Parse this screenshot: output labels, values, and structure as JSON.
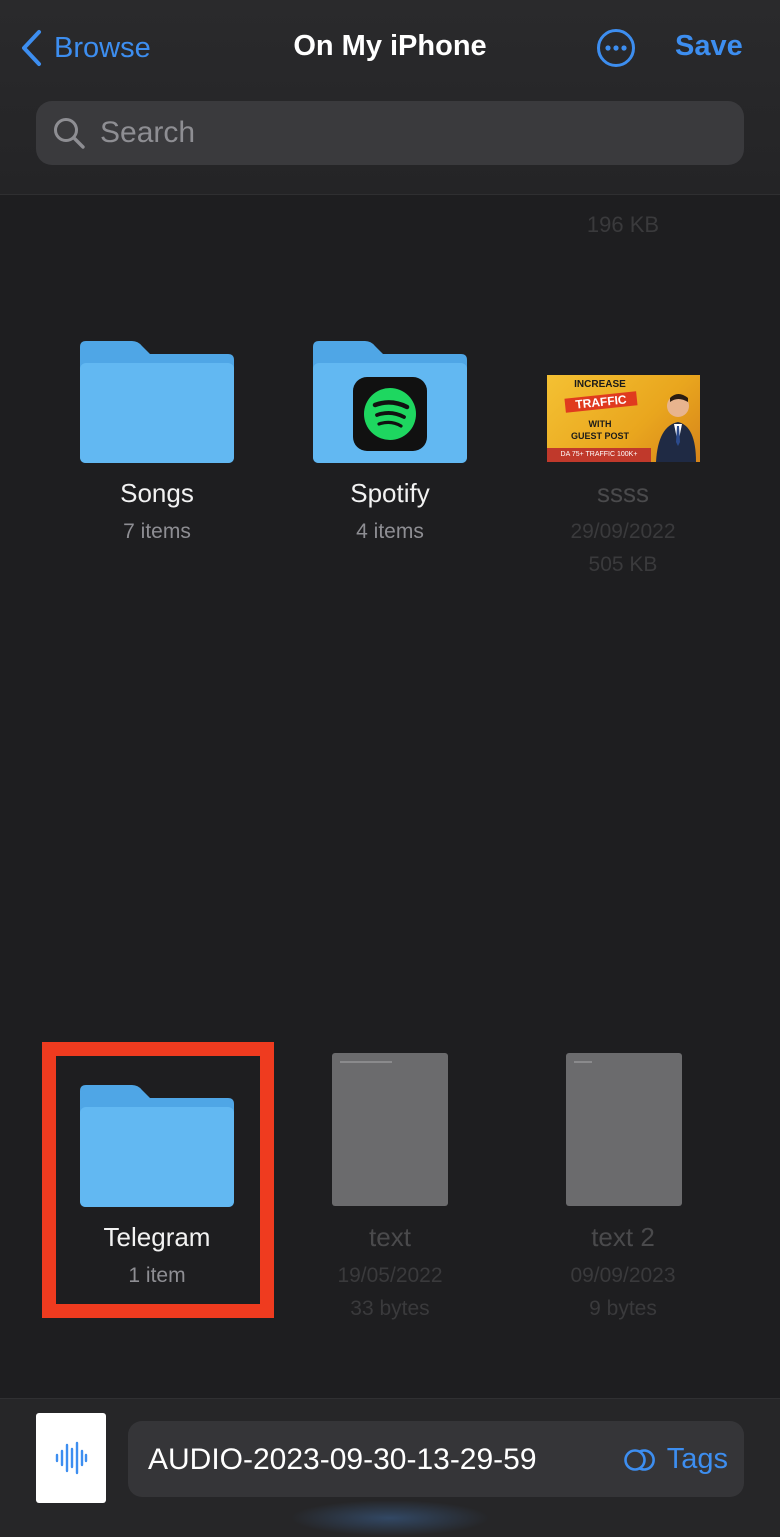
{
  "nav": {
    "back_label": "Browse",
    "title": "On My iPhone",
    "save_label": "Save"
  },
  "search": {
    "placeholder": "Search"
  },
  "cutoff_row": {
    "col3_size": "196 KB"
  },
  "items": [
    {
      "name": "Songs",
      "meta1": "7 items",
      "meta2": "",
      "type": "folder"
    },
    {
      "name": "Spotify",
      "meta1": "4 items",
      "meta2": "",
      "type": "folder-spotify"
    },
    {
      "name": "ssss",
      "meta1": "29/09/2022",
      "meta2": "505 KB",
      "type": "image"
    },
    {
      "name": "Telegram",
      "meta1": "1 item",
      "meta2": "",
      "type": "folder"
    },
    {
      "name": "text",
      "meta1": "19/05/2022",
      "meta2": "33 bytes",
      "type": "document"
    },
    {
      "name": "text 2",
      "meta1": "09/09/2023",
      "meta2": "9 bytes",
      "type": "document"
    }
  ],
  "ad_thumb": {
    "line1": "INCREASE",
    "line2": "TRAFFIC",
    "line3": "WITH",
    "line4": "GUEST POST",
    "line5": "DA 75+ TRAFFIC 100K+"
  },
  "bottom": {
    "filename": "AUDIO-2023-09-30-13-29-59",
    "tags_label": "Tags"
  },
  "colors": {
    "accent": "#3d8ef0",
    "highlight": "#ef3b1f",
    "folder": "#5ab4f0",
    "background": "#1e1e20"
  }
}
